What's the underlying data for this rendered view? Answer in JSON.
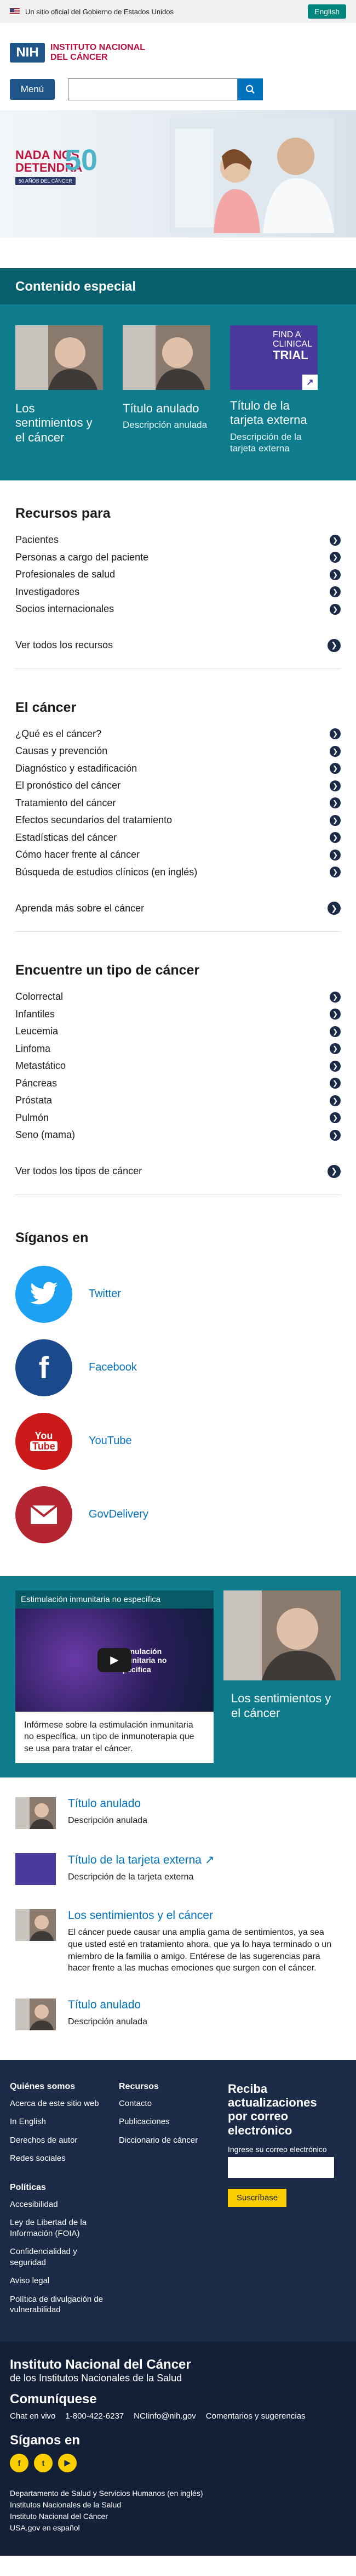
{
  "gov_banner": {
    "text": "Un sitio oficial del Gobierno de Estados Unidos",
    "lang_button": "English"
  },
  "header": {
    "logo_short": "NIH",
    "logo_line1": "INSTITUTO NACIONAL",
    "logo_line2": "DEL CÁNCER",
    "menu_label": "Menú",
    "search_placeholder": ""
  },
  "hero": {
    "line1": "NADA NOS",
    "line2": "DETENDRÁ",
    "small": "50 AÑOS DEL CÁNCER",
    "number": "50"
  },
  "special": {
    "title": "Contenido especial",
    "cards": [
      {
        "title": "Los sentimientos y el cáncer",
        "desc": ""
      },
      {
        "title": "Título anulado",
        "desc": "Descripción anulada"
      },
      {
        "title": "Título de la tarjeta externa",
        "desc": "Descripción de la tarjeta externa",
        "badge_line1": "FIND A",
        "badge_line2": "CLINICAL",
        "badge_line3": "TRIAL"
      }
    ]
  },
  "recursos": {
    "title": "Recursos para",
    "items": [
      "Pacientes",
      "Personas a cargo del paciente",
      "Profesionales de salud",
      "Investigadores",
      "Socios internacionales"
    ],
    "view_all": "Ver todos los recursos"
  },
  "cancer": {
    "title": "El cáncer",
    "items": [
      "¿Qué es el cáncer?",
      "Causas y prevención",
      "Diagnóstico y estadificación",
      "El pronóstico del cáncer",
      "Tratamiento del cáncer",
      "Efectos secundarios del tratamiento",
      "Estadísticas del cáncer",
      "Cómo hacer frente al cáncer",
      "Búsqueda de estudios clínicos (en inglés)"
    ],
    "view_all": "Aprenda más sobre el cáncer"
  },
  "tipos": {
    "title": "Encuentre un tipo de cáncer",
    "items": [
      "Colorrectal",
      "Infantiles",
      "Leucemia",
      "Linfoma",
      "Metastático",
      "Páncreas",
      "Próstata",
      "Pulmón",
      "Seno (mama)"
    ],
    "view_all": "Ver todos los tipos de cáncer"
  },
  "social": {
    "title": "Síganos en",
    "items": [
      {
        "label": "Twitter",
        "icon": "twitter-icon",
        "color": "#1da1f2"
      },
      {
        "label": "Facebook",
        "icon": "facebook-icon",
        "color": "#1b4a8c"
      },
      {
        "label": "YouTube",
        "icon": "youtube-icon",
        "color": "#cc1a1a"
      },
      {
        "label": "GovDelivery",
        "icon": "email-icon",
        "color": "#b32530"
      }
    ]
  },
  "video": {
    "title": "Estimulación inmunitaria no específica",
    "overlay": "Estimulación inmunitaria no específica",
    "desc": "Infórmese sobre la estimulación inmunitaria no específica, un tipo de inmunoterapia que se usa para tratar el cáncer."
  },
  "aside": {
    "title": "Los sentimientos y el cáncer"
  },
  "features": [
    {
      "title": "Título anulado",
      "desc": "Descripción anulada"
    },
    {
      "title": "Título de la tarjeta externa",
      "desc": "Descripción de la tarjeta externa"
    },
    {
      "title": "Los sentimientos y el cáncer",
      "desc": "El cáncer puede causar una amplia gama de sentimientos, ya sea que usted esté en tratamiento ahora, que ya lo haya terminado o un miembro de la familia o amigo. Entérese de las sugerencias para hacer frente a las muchas emociones que surgen con el cáncer."
    },
    {
      "title": "Título anulado",
      "desc": "Descripción anulada"
    }
  ],
  "footer": {
    "col1": {
      "title": "Quiénes somos",
      "links": [
        "Acerca de este sitio web",
        "In English",
        "Derechos de autor",
        "Redes sociales"
      ]
    },
    "col2": {
      "title": "Recursos",
      "links": [
        "Contacto",
        "Publicaciones",
        "Diccionario de cáncer"
      ]
    },
    "col3": {
      "title": "Políticas",
      "links": [
        "Accesibilidad",
        "Ley de Libertad de la Información (FOIA)",
        "Confidencialidad y seguridad",
        "Aviso legal",
        "Política de divulgación de vulnerabilidad"
      ]
    },
    "subscribe": {
      "title": "Reciba actualizaciones por correo electrónico",
      "label": "Ingrese su correo electrónico",
      "button": "Suscríbase"
    }
  },
  "bottom": {
    "org_name": "Instituto Nacional del Cáncer",
    "org_sub": "de los Institutos Nacionales de la Salud",
    "comm_title": "Comuníquese",
    "chat": "Chat en vivo",
    "phone": "1-800-422-6237",
    "email": "NCIinfo@nih.gov",
    "comments": "Comentarios y sugerencias",
    "follow_title": "Síganos en",
    "links": [
      "Departamento de Salud y Servicios Humanos (en inglés)",
      "Institutos Nacionales de la Salud",
      "Instituto Nacional del Cáncer",
      "USA.gov en español"
    ]
  }
}
